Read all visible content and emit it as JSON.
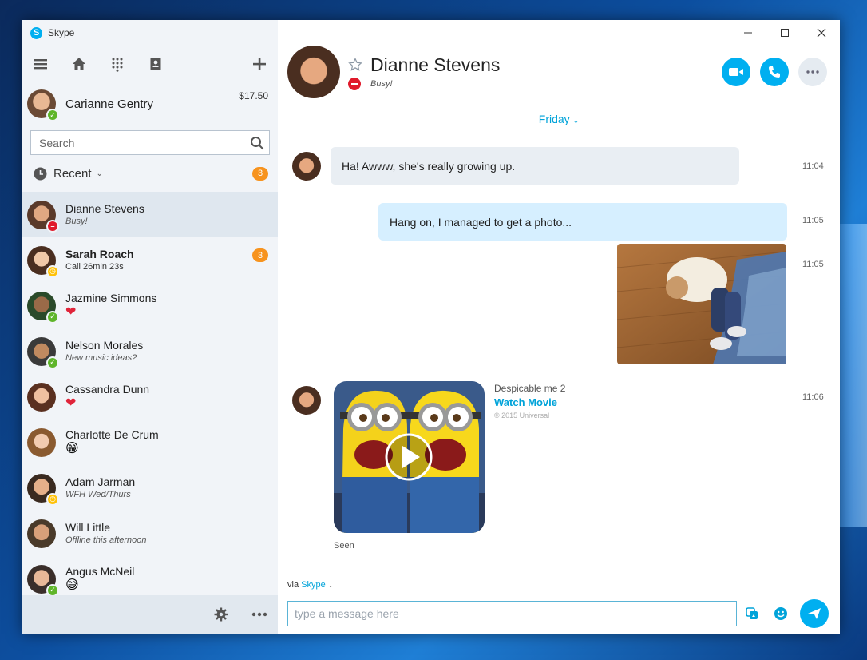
{
  "app": {
    "title": "Skype"
  },
  "me": {
    "name": "Carianne Gentry",
    "credit": "$17.50"
  },
  "search": {
    "placeholder": "Search"
  },
  "recent": {
    "label": "Recent",
    "badge": "3"
  },
  "contacts": [
    {
      "name": "Dianne Stevens",
      "status": "Busy!",
      "presence": "busy"
    },
    {
      "name": "Sarah Roach",
      "status": "Call 26min 23s",
      "presence": "away",
      "badge": "3"
    },
    {
      "name": "Jazmine Simmons",
      "status": "❤",
      "presence": "online"
    },
    {
      "name": "Nelson Morales",
      "status": "New music ideas?",
      "presence": "online"
    },
    {
      "name": "Cassandra Dunn",
      "status": "❤",
      "presence": "none"
    },
    {
      "name": "Charlotte De Crum",
      "status": "😁",
      "presence": "none"
    },
    {
      "name": "Adam Jarman",
      "status": "WFH Wed/Thurs",
      "presence": "away"
    },
    {
      "name": "Will Little",
      "status": "Offline this afternoon",
      "presence": "none"
    },
    {
      "name": "Angus McNeil",
      "status": "😅",
      "presence": "online"
    }
  ],
  "conversation": {
    "name": "Dianne Stevens",
    "status": "Busy!",
    "day": "Friday",
    "messages": [
      {
        "text": "Ha! Awww, she's really growing up.",
        "time": "11:04"
      },
      {
        "text": "Hang on, I managed to get a photo...",
        "time": "11:05"
      },
      {
        "time": "11:05"
      },
      {
        "time": "11:06"
      }
    ],
    "movie": {
      "title": "Despicable me 2",
      "link": "Watch Movie",
      "copyright": "© 2015 Universal"
    },
    "seen": "Seen"
  },
  "composer": {
    "via": "via",
    "service": "Skype",
    "placeholder": "type a message here"
  },
  "colors": {
    "accent": "#00aff0",
    "busy": "#e01a2b",
    "online": "#5fb52a",
    "away": "#ffc107",
    "badge": "#f7931e"
  }
}
